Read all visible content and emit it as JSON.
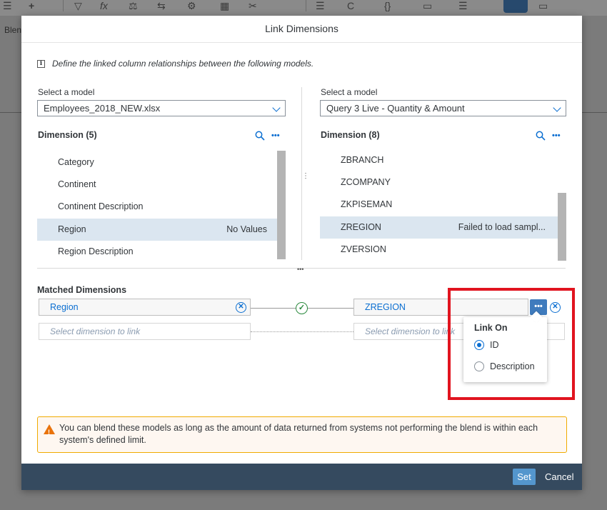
{
  "background": {
    "toolbar_icons": [
      "+",
      "▽",
      "fx",
      "⚖",
      "⇆",
      "⚙",
      "▦",
      "✂",
      "☰",
      "C",
      "{}",
      "▭",
      "☰"
    ],
    "tab_label": "Blen"
  },
  "dialog": {
    "title": "Link Dimensions",
    "info_text": "Define the linked column relationships between the following models.",
    "left": {
      "select_label": "Select a model",
      "model": "Employees_2018_NEW.xlsx",
      "dimension_header": "Dimension  (5)",
      "items": [
        {
          "name": "Category",
          "note": ""
        },
        {
          "name": "Continent",
          "note": ""
        },
        {
          "name": "Continent Description",
          "note": ""
        },
        {
          "name": "Region",
          "note": "No Values"
        },
        {
          "name": "Region Description",
          "note": ""
        }
      ]
    },
    "right": {
      "select_label": "Select a model",
      "model": "Query 3 Live - Quantity & Amount",
      "dimension_header": "Dimension  (8)",
      "items": [
        {
          "name": "ZBRANCH",
          "note": ""
        },
        {
          "name": "ZCOMPANY",
          "note": ""
        },
        {
          "name": "ZKPISEMAN",
          "note": ""
        },
        {
          "name": "ZREGION",
          "note": "Failed to load sampl..."
        },
        {
          "name": "ZVERSION",
          "note": ""
        }
      ]
    },
    "matched": {
      "header": "Matched Dimensions",
      "left_value": "Region",
      "right_value": "ZREGION",
      "placeholder_left": "Select dimension to link",
      "placeholder_right": "Select dimension to link"
    },
    "popover": {
      "title": "Link On",
      "options": [
        "ID",
        "Description"
      ],
      "selected": "ID"
    },
    "warning": "You can blend these models as long as the amount of data returned from systems not performing the blend is within each system's defined limit.",
    "footer": {
      "set_label": "Set",
      "cancel_label": "Cancel"
    }
  },
  "colors": {
    "accent": "#0a6ed1",
    "selected_row": "#dbe6f0",
    "footer": "#354a5f",
    "highlight": "#e1141f",
    "warning_border": "#f0ab00"
  }
}
